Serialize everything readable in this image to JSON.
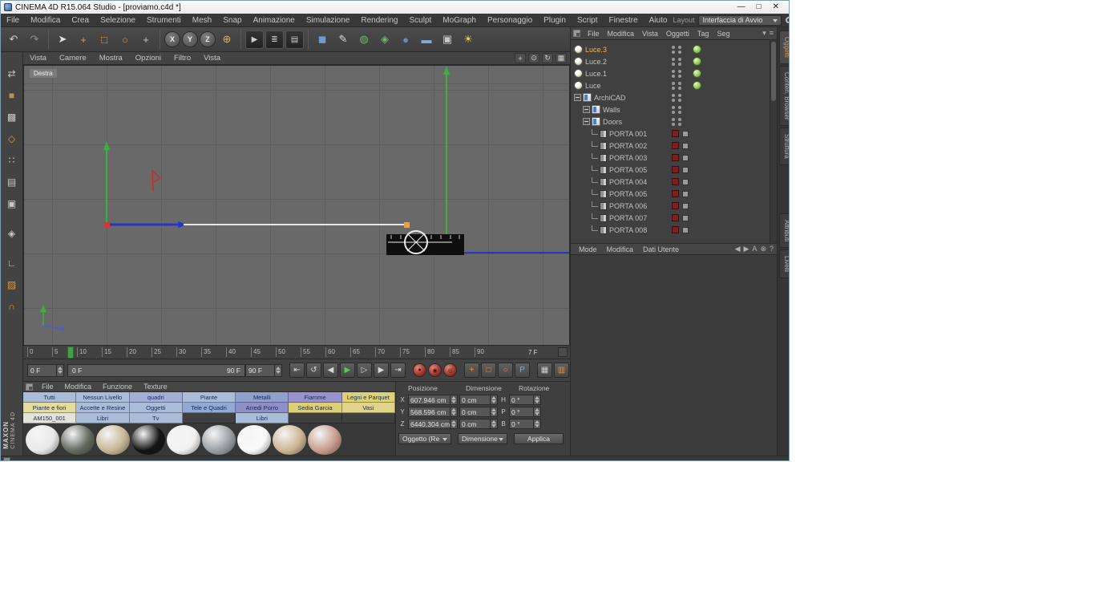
{
  "window": {
    "title": "CINEMA 4D R15.064 Studio - [proviamo.c4d *]",
    "minimize": "—",
    "maximize": "□",
    "close": "✕"
  },
  "menubar": {
    "items": [
      "File",
      "Modifica",
      "Crea",
      "Selezione",
      "Strumenti",
      "Mesh",
      "Snap",
      "Animazione",
      "Simulazione",
      "Rendering",
      "Sculpt",
      "MoGraph",
      "Personaggio",
      "Plugin",
      "Script",
      "Finestre",
      "Aiuto"
    ],
    "layout_label": "Layout",
    "layout_value": "Interfaccia di Avvio"
  },
  "toolbar": {
    "icons": [
      {
        "name": "undo-icon",
        "glyph": "↶",
        "color": "#d2d2d2"
      },
      {
        "name": "redo-icon",
        "glyph": "↷",
        "color": "#8f8f8f"
      },
      {
        "sep": true
      },
      {
        "name": "live-selection-icon",
        "glyph": "➤",
        "color": "#e2e2e2"
      },
      {
        "name": "move-icon",
        "glyph": "+",
        "color": "#e0953c"
      },
      {
        "name": "scale-icon",
        "glyph": "□",
        "color": "#e0953c"
      },
      {
        "name": "rotate-icon",
        "glyph": "○",
        "color": "#e0953c"
      },
      {
        "name": "last-tool-icon",
        "glyph": "+",
        "color": "#c8c8c8"
      },
      {
        "sep": true
      },
      {
        "name": "lock-x-icon",
        "glyph": "X",
        "circle": true
      },
      {
        "name": "lock-y-icon",
        "glyph": "Y",
        "circle": true
      },
      {
        "name": "lock-z-icon",
        "glyph": "Z",
        "circle": true
      },
      {
        "name": "coordinate-system-icon",
        "glyph": "⊕",
        "color": "#d8b068"
      },
      {
        "sep": true
      },
      {
        "name": "render-view-icon",
        "glyph": "▶",
        "color": "#cccccc",
        "dark": true
      },
      {
        "name": "render-settings-icon",
        "glyph": "≣",
        "color": "#cccccc",
        "dark": true
      },
      {
        "name": "render-queue-icon",
        "glyph": "▤",
        "color": "#cccccc",
        "dark": true
      },
      {
        "sep": true
      },
      {
        "name": "add-cube-icon",
        "glyph": "◼",
        "color": "#6b9bd2"
      },
      {
        "name": "add-spline-icon",
        "glyph": "✎",
        "color": "#d8d8d8"
      },
      {
        "name": "add-generator-icon",
        "glyph": "◍",
        "color": "#68b868"
      },
      {
        "name": "add-modifier-icon",
        "glyph": "◈",
        "color": "#68b868"
      },
      {
        "name": "add-deformer-icon",
        "glyph": "●",
        "color": "#6888c8"
      },
      {
        "name": "add-environment-icon",
        "glyph": "▬",
        "color": "#88a8d0"
      },
      {
        "name": "add-camera-icon",
        "glyph": "▣",
        "color": "#c8c8c8"
      },
      {
        "name": "add-light-icon",
        "glyph": "☀",
        "color": "#e8d858"
      }
    ]
  },
  "side_toolbar": {
    "icons": [
      {
        "name": "convert-icon",
        "glyph": "⇄",
        "color": "#c8c8c8",
        "gap": true
      },
      {
        "name": "model-mode-icon",
        "glyph": "■",
        "color": "#b89058"
      },
      {
        "name": "texture-mode-icon",
        "glyph": "▩",
        "color": "#c8c8c8"
      },
      {
        "name": "workplane-icon",
        "glyph": "◇",
        "color": "#e0953c"
      },
      {
        "name": "points-mode-icon",
        "glyph": "∷",
        "color": "#c8c8c8"
      },
      {
        "name": "edges-mode-icon",
        "glyph": "▤",
        "color": "#c8c8c8"
      },
      {
        "name": "polygons-mode-icon",
        "glyph": "▣",
        "color": "#c8c8c8"
      },
      {
        "name": "tweak-mode-icon",
        "glyph": "◈",
        "color": "#c8c8c8",
        "gap": true
      },
      {
        "name": "axis-mode-icon",
        "glyph": "∟",
        "color": "#c8c8c8",
        "gap": true
      },
      {
        "name": "texture-paint-icon",
        "glyph": "▨",
        "color": "#e0953c"
      },
      {
        "name": "snap-icon",
        "glyph": "∩",
        "color": "#e0953c"
      }
    ],
    "brand": [
      "MAXON",
      "CINEMA 4D"
    ]
  },
  "viewport": {
    "view_label": "Destra",
    "menu": [
      "Vista",
      "Camere",
      "Mostra",
      "Opzioni",
      "Filtro",
      "Vista"
    ],
    "nav_icons": [
      {
        "name": "pan-view-icon",
        "glyph": "+"
      },
      {
        "name": "zoom-view-icon",
        "glyph": "⊙"
      },
      {
        "name": "rotate-view-icon",
        "glyph": "↻"
      },
      {
        "name": "toggle-views-icon",
        "glyph": "▦"
      }
    ]
  },
  "timeline": {
    "ticks": [
      "0",
      "5",
      "10",
      "15",
      "20",
      "25",
      "30",
      "35",
      "40",
      "45",
      "50",
      "55",
      "60",
      "65",
      "70",
      "75",
      "80",
      "85",
      "90"
    ],
    "current_frame": "7 F"
  },
  "playback": {
    "start_field": "0 F",
    "range_start": "0 F",
    "range_end": "90 F",
    "end_field": "90 F",
    "transport": [
      {
        "name": "goto-start-button",
        "glyph": "⇤"
      },
      {
        "name": "play-backwards-button",
        "glyph": "↺"
      },
      {
        "name": "previous-frame-button",
        "glyph": "◀"
      },
      {
        "name": "play-button",
        "glyph": "▶",
        "color": "#58c858"
      },
      {
        "name": "next-frame-button",
        "glyph": "▷"
      },
      {
        "name": "next-key-button",
        "glyph": "▶"
      },
      {
        "name": "goto-end-button",
        "glyph": "⇥"
      }
    ],
    "record": [
      {
        "name": "record-keyframe-button",
        "glyph": "●"
      },
      {
        "name": "autokeying-button",
        "glyph": "◉"
      },
      {
        "name": "keyframe-selection-button",
        "glyph": "◎"
      }
    ],
    "keys": [
      {
        "name": "record-position-icon",
        "glyph": "+",
        "color": "#e8953c"
      },
      {
        "name": "record-scale-icon",
        "glyph": "□",
        "color": "#e8953c"
      },
      {
        "name": "record-rotation-icon",
        "glyph": "○",
        "color": "#e8953c"
      },
      {
        "name": "record-parameter-icon",
        "glyph": "P",
        "color": "#7ab0e8"
      }
    ],
    "extras": [
      {
        "name": "pla-icon",
        "glyph": "▦",
        "color": "#d0d0d0"
      },
      {
        "name": "keying-panel-icon",
        "glyph": "▥",
        "color": "#e0953c"
      }
    ]
  },
  "materials": {
    "menu": [
      "File",
      "Modifica",
      "Funzione",
      "Texture"
    ],
    "layers": [
      {
        "label": "Tutti",
        "bg": "#a9bdd8"
      },
      {
        "label": "Nessun Livello",
        "bg": "#a9bdd8"
      },
      {
        "label": "quadri",
        "bg": "#a2aed6"
      },
      {
        "label": "Piante",
        "bg": "#a9bdd8"
      },
      {
        "label": "Metalli",
        "bg": "#8fa0cd"
      },
      {
        "label": "Fiamme",
        "bg": "#9a92cc"
      },
      {
        "label": "Legni e Parquet",
        "bg": "#ded173"
      },
      {
        "label": "Piante e fiori",
        "bg": "#e4dc9e"
      },
      {
        "label": "Accette e Resine",
        "bg": "#a9bdd8"
      },
      {
        "label": "Oggetti",
        "bg": "#a9bdd8"
      },
      {
        "label": "Tele e Quadri",
        "bg": "#93a8d2"
      },
      {
        "label": "Arredi Porro",
        "bg": "#8f8fc8"
      },
      {
        "label": "Sedia Garcia",
        "bg": "#ddcf78"
      },
      {
        "label": "Vasi",
        "bg": "#e0d48a"
      },
      {
        "label": "AM150_001",
        "bg": "#e3e3da"
      },
      {
        "label": "Libri",
        "bg": "#a9bdd8"
      },
      {
        "label": "Tv",
        "bg": "#a9bdd8"
      },
      {
        "label": "",
        "bg": ""
      },
      {
        "label": "Libri",
        "bg": "#a9bdd8"
      },
      {
        "label": "",
        "bg": ""
      },
      {
        "label": "",
        "bg": ""
      }
    ],
    "thumbnails": [
      {
        "color": "#e9e9e9"
      },
      {
        "color": "#646a5e"
      },
      {
        "color": "#c8b795"
      },
      {
        "color": "#141414"
      },
      {
        "color": "#f2f2f2"
      },
      {
        "color": "#9aa0a6"
      },
      {
        "color": "#fafafa"
      },
      {
        "color": "#cdb693"
      },
      {
        "color": "#c79d8d"
      }
    ]
  },
  "coordinates": {
    "headers": [
      "Posizione",
      "Dimensione",
      "Rotazione"
    ],
    "rows": [
      {
        "axis": "X",
        "pos": "607.946 cm",
        "size": "0 cm",
        "rot_axis": "H",
        "rot": "0 °"
      },
      {
        "axis": "Y",
        "pos": "568.596 cm",
        "size": "0 cm",
        "rot_axis": "P",
        "rot": "0 °"
      },
      {
        "axis": "Z",
        "pos": "6440.304 cm",
        "size": "0 cm",
        "rot_axis": "B",
        "rot": "0 °"
      }
    ],
    "mode_object": "Oggetto (Re",
    "mode_size": "Dimensione",
    "apply": "Applica"
  },
  "object_manager": {
    "menu": [
      "File",
      "Modifica",
      "Vista",
      "Oggetti",
      "Tag",
      "Seg"
    ],
    "right_icons": [
      {
        "name": "filter-icon",
        "glyph": "▾"
      },
      {
        "name": "options-icon",
        "glyph": "≡"
      }
    ],
    "objects": [
      {
        "name": "Luce.3",
        "kind": "light",
        "indent": 0,
        "tag": "green",
        "selected": true
      },
      {
        "name": "Luce.2",
        "kind": "light",
        "indent": 0,
        "tag": "green",
        "selected": false
      },
      {
        "name": "Luce.1",
        "kind": "light",
        "indent": 0,
        "tag": "green",
        "selected": false
      },
      {
        "name": "Luce",
        "kind": "light",
        "indent": 0,
        "tag": "green",
        "selected": false
      },
      {
        "name": "ArchiCAD",
        "kind": "group",
        "indent": 0,
        "tag": "",
        "selected": false
      },
      {
        "name": "Walls",
        "kind": "group",
        "indent": 1,
        "tag": "",
        "selected": false
      },
      {
        "name": "Doors",
        "kind": "group",
        "indent": 1,
        "tag": "",
        "selected": false
      },
      {
        "name": "PORTA 001",
        "kind": "door",
        "indent": 2,
        "tag": "red",
        "selected": false
      },
      {
        "name": "PORTA 002",
        "kind": "door",
        "indent": 2,
        "tag": "red",
        "selected": false
      },
      {
        "name": "PORTA 003",
        "kind": "door",
        "indent": 2,
        "tag": "red",
        "selected": false
      },
      {
        "name": "PORTA 005",
        "kind": "door",
        "indent": 2,
        "tag": "red",
        "selected": false
      },
      {
        "name": "PORTA 004",
        "kind": "door",
        "indent": 2,
        "tag": "red",
        "selected": false
      },
      {
        "name": "PORTA 005",
        "kind": "door",
        "indent": 2,
        "tag": "red",
        "selected": false
      },
      {
        "name": "PORTA 006",
        "kind": "door",
        "indent": 2,
        "tag": "red",
        "selected": false
      },
      {
        "name": "PORTA 007",
        "kind": "door",
        "indent": 2,
        "tag": "red",
        "selected": false
      },
      {
        "name": "PORTA 008",
        "kind": "door",
        "indent": 2,
        "tag": "red",
        "selected": false
      }
    ]
  },
  "attribute_manager": {
    "menu": [
      "Mode",
      "Modifica",
      "Dati Utente"
    ],
    "right_icons": [
      {
        "name": "nav-back-icon",
        "glyph": "◀"
      },
      {
        "name": "nav-forward-icon",
        "glyph": "▶"
      },
      {
        "name": "ae-mode-icon",
        "glyph": "A"
      },
      {
        "name": "lock-icon",
        "glyph": "⊗"
      },
      {
        "name": "help-icon",
        "glyph": "?"
      }
    ]
  },
  "side_tabs": {
    "top": [
      {
        "label": "Oggetti",
        "active": true
      },
      {
        "label": "Conten. Browser",
        "active": false
      },
      {
        "label": "Struttura",
        "active": false
      }
    ],
    "bottom": [
      {
        "label": "Attributi",
        "active": false
      },
      {
        "label": "Livelli",
        "active": false
      }
    ]
  },
  "colors": {
    "accent_orange": "#e8953c",
    "tag_red": "#7e1f1f",
    "tag_green": "#8ac050",
    "axis_green": "#3fae3f",
    "axis_blue": "#2438c8",
    "viewport_bg": "#696969"
  }
}
